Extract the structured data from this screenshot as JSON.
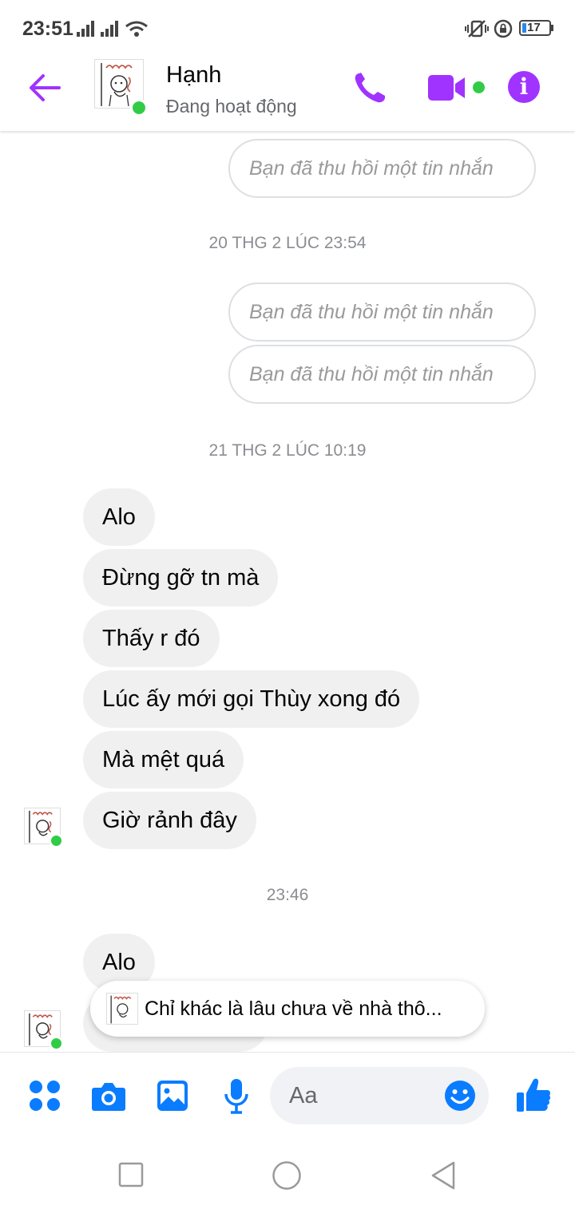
{
  "status_bar": {
    "time": "23:51",
    "battery": "17"
  },
  "header": {
    "contact_name": "Hạnh",
    "contact_status": "Đang hoạt động",
    "accent_color": "#a033ff",
    "online_color": "#31cc46"
  },
  "messages": {
    "recalled_1": "Bạn đã thu hồi một tin nhắn",
    "timestamp_1": "20 THG 2 LÚC 23:54",
    "recalled_2": "Bạn đã thu hồi một tin nhắn",
    "recalled_3": "Bạn đã thu hồi một tin nhắn",
    "timestamp_2": "21 THG 2 LÚC 10:19",
    "incoming": [
      "Alo",
      "Đừng gỡ tn mà",
      "Thấy r đó",
      "Lúc ấy mới gọi Thùy xong đó",
      "Mà mệt quá",
      "Giờ rảnh đây"
    ],
    "timestamp_3": "23:46",
    "incoming_2": [
      "Alo"
    ]
  },
  "reply_preview": {
    "text": "Chỉ khác là lâu chưa về nhà thô..."
  },
  "composer": {
    "placeholder": "Aa",
    "icon_color": "#0a7cff",
    "icons": [
      "menu-dots-icon",
      "camera-icon",
      "gallery-icon",
      "microphone-icon",
      "emoji-icon",
      "thumbs-up-icon"
    ]
  },
  "nav_bar": {
    "icons": [
      "recent-apps-icon",
      "home-icon",
      "back-icon"
    ]
  }
}
